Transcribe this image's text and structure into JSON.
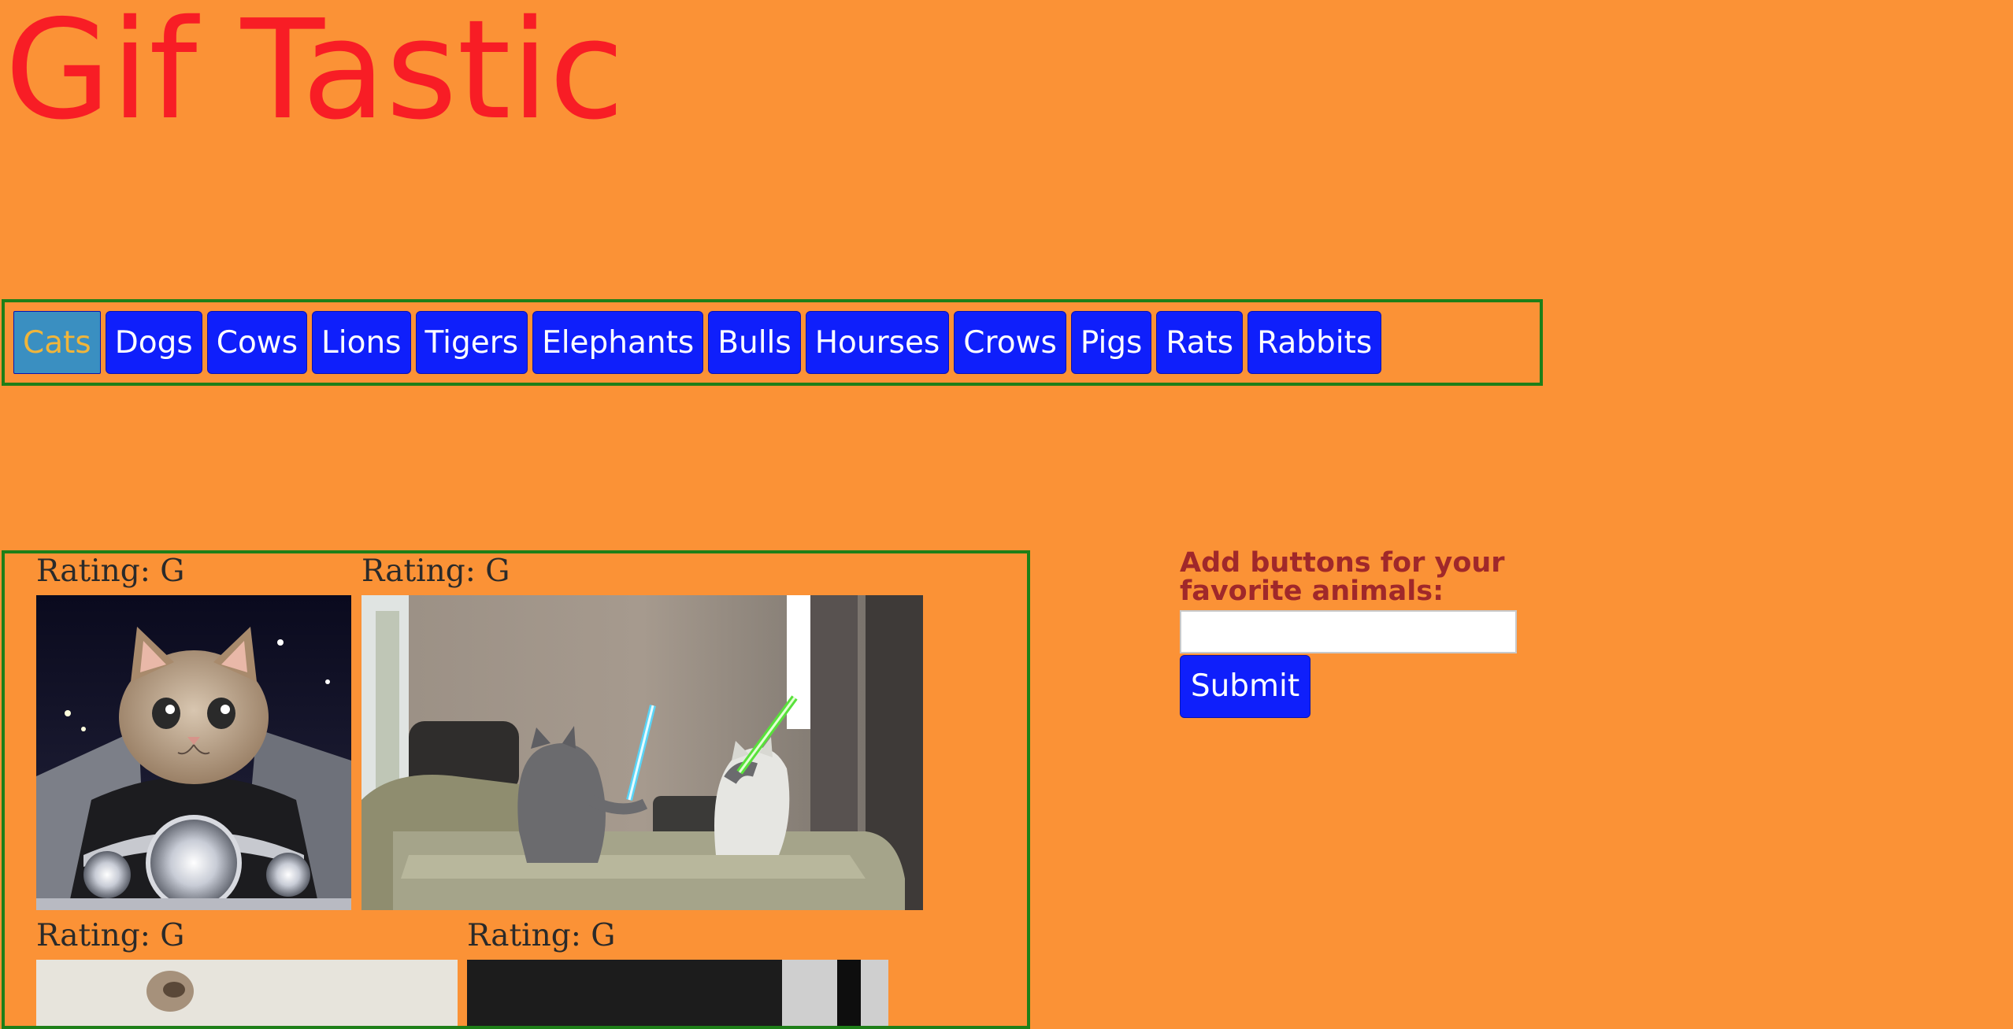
{
  "title": "Gif Tastic",
  "animal_buttons": [
    {
      "label": "Cats",
      "active": true
    },
    {
      "label": "Dogs",
      "active": false
    },
    {
      "label": "Cows",
      "active": false
    },
    {
      "label": "Lions",
      "active": false
    },
    {
      "label": "Tigers",
      "active": false
    },
    {
      "label": "Elephants",
      "active": false
    },
    {
      "label": "Bulls",
      "active": false
    },
    {
      "label": "Hourses",
      "active": false
    },
    {
      "label": "Crows",
      "active": false
    },
    {
      "label": "Pigs",
      "active": false
    },
    {
      "label": "Rats",
      "active": false
    },
    {
      "label": "Rabbits",
      "active": false
    }
  ],
  "gifs": [
    {
      "rating": "Rating: G",
      "icon": "kitten-on-motorcycle-gif"
    },
    {
      "rating": "Rating: G",
      "icon": "cats-lightsaber-fight-gif"
    },
    {
      "rating": "Rating: G",
      "icon": "cat-gif"
    },
    {
      "rating": "Rating: G",
      "icon": "cat-gif"
    }
  ],
  "form": {
    "label": "Add buttons for your favorite animals:",
    "input_value": "",
    "submit_label": "Submit"
  },
  "colors": {
    "background": "#fb9236",
    "title": "#f81d25",
    "button": "#0f1ffb",
    "active_button": "#3a8fc1",
    "border": "#1e7f18",
    "form_label": "#a0282a"
  }
}
